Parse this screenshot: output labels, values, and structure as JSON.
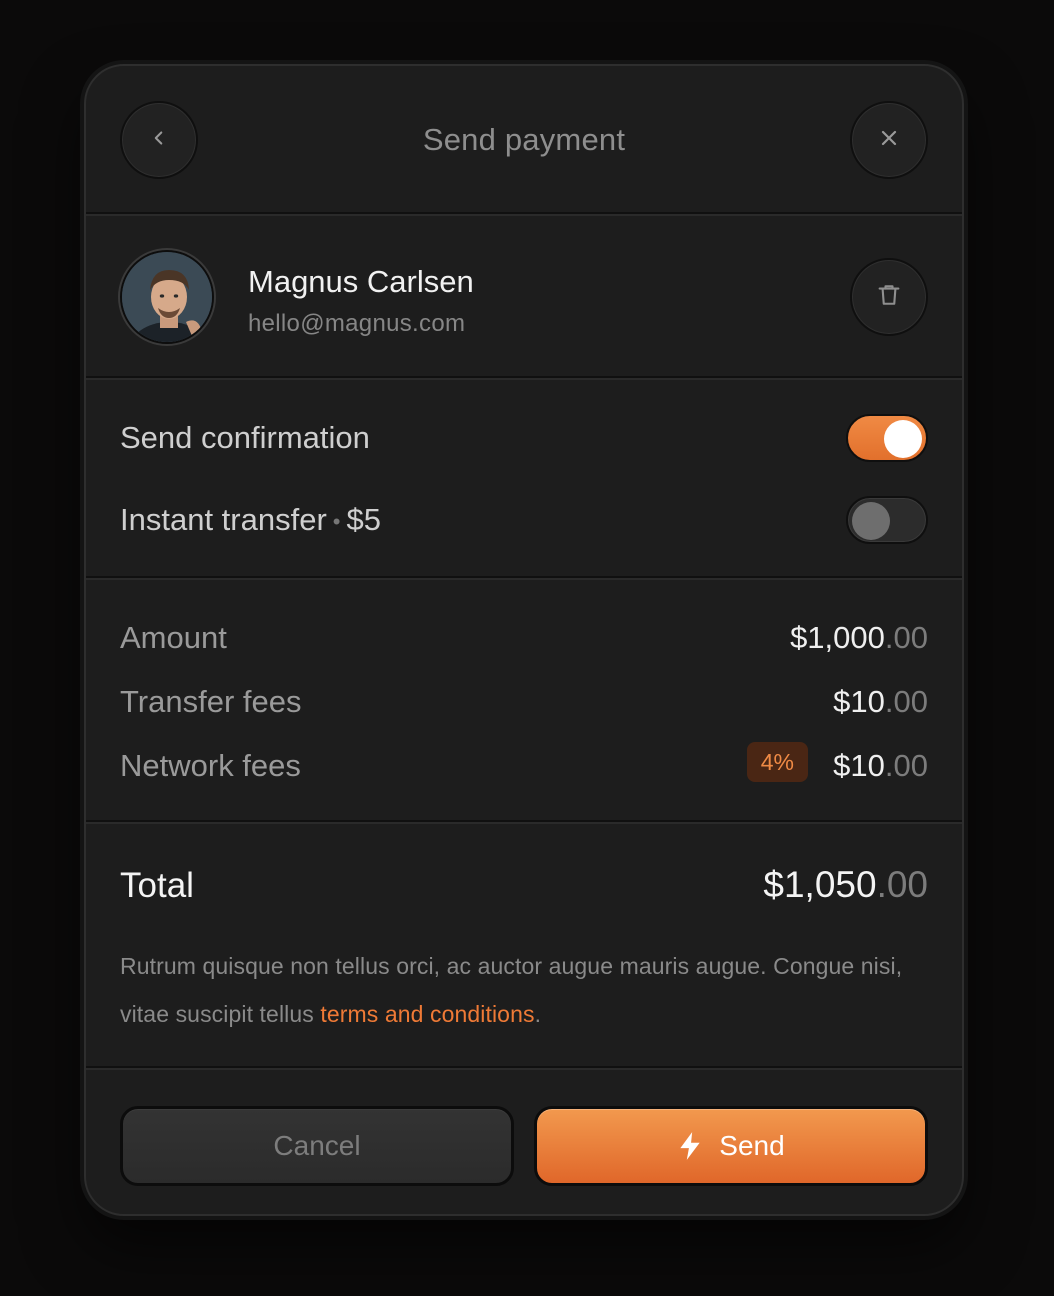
{
  "header": {
    "title": "Send payment",
    "back_icon": "chevron-left-icon",
    "close_icon": "close-icon"
  },
  "recipient": {
    "name": "Magnus Carlsen",
    "email": "hello@magnus.com",
    "delete_icon": "trash-icon"
  },
  "toggles": [
    {
      "label": "Send confirmation",
      "suffix": "",
      "on": true
    },
    {
      "label": "Instant transfer",
      "suffix": "$5",
      "on": false
    }
  ],
  "fees": [
    {
      "label": "Amount",
      "value_main": "$1,000",
      "value_cents": ".00",
      "badge": ""
    },
    {
      "label": "Transfer fees",
      "value_main": "$10",
      "value_cents": ".00",
      "badge": ""
    },
    {
      "label": "Network fees",
      "value_main": "$10",
      "value_cents": ".00",
      "badge": "4%"
    }
  ],
  "total": {
    "label": "Total",
    "value_main": "$1,050",
    "value_cents": ".00",
    "disclaimer_text": "Rutrum quisque non tellus orci, ac auctor augue mauris augue. Congue nisi, vitae suscipit tellus ",
    "disclaimer_link": "terms and conditions",
    "disclaimer_end": "."
  },
  "footer": {
    "cancel_label": "Cancel",
    "send_label": "Send",
    "send_icon": "lightning-icon"
  },
  "colors": {
    "accent": "#E8773A",
    "background": "#1D1D1D",
    "badge_bg": "#4A2614"
  }
}
